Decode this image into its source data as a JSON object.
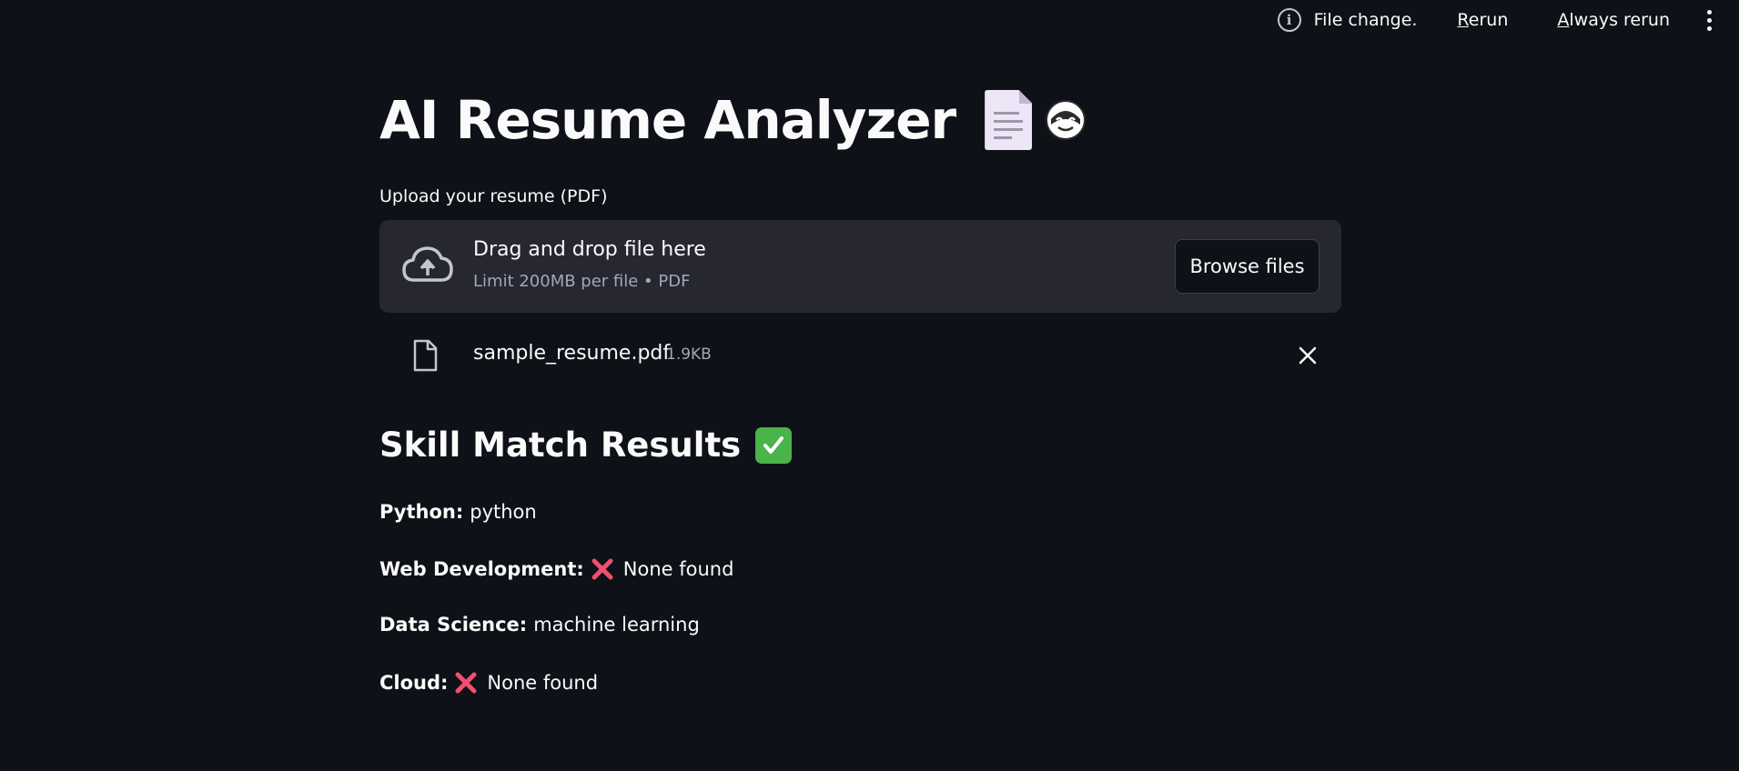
{
  "status_bar": {
    "message": "File change.",
    "rerun_accel": "R",
    "rerun_rest": "erun",
    "always_accel": "A",
    "always_rest": "lways rerun"
  },
  "main": {
    "title": "AI Resume Analyzer",
    "upload_label": "Upload your resume (PDF)",
    "dropzone": {
      "title": "Drag and drop file here",
      "subtitle": "Limit 200MB per file • PDF",
      "browse_label": "Browse files"
    },
    "uploaded_file": {
      "name": "sample_resume.pdf",
      "size": "1.9KB"
    },
    "results_title": "Skill Match Results",
    "skills": [
      {
        "label": "Python:",
        "value": "python",
        "missing": false
      },
      {
        "label": "Web Development:",
        "value": "None found",
        "missing": true
      },
      {
        "label": "Data Science:",
        "value": "machine learning",
        "missing": false
      },
      {
        "label": "Cloud:",
        "value": "None found",
        "missing": true
      }
    ]
  },
  "colors": {
    "background": "#0e1117",
    "dropzone": "#262730",
    "text": "#fafafa",
    "muted": "#a3a8b8",
    "cross": "#f0506e",
    "check": "#4ab34a"
  },
  "icons": {
    "info": "info-icon",
    "menu": "kebab-menu-icon",
    "upload": "cloud-upload-icon",
    "file": "file-icon",
    "remove": "close-icon",
    "missing": "cross-mark-icon",
    "success": "check-mark-icon"
  }
}
